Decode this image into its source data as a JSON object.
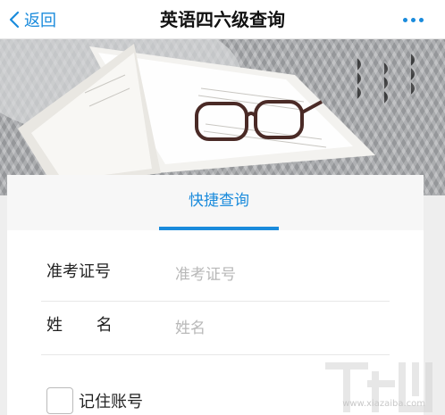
{
  "nav": {
    "back_label": "返回",
    "title": "英语四六级查询"
  },
  "tabs": [
    {
      "label": "快捷查询",
      "active": true
    }
  ],
  "form": {
    "ticket_label": "准考证号",
    "ticket_placeholder": "准考证号",
    "name_label": "姓 名",
    "name_placeholder": "姓名",
    "remember_label": "记住账号",
    "remember_checked": false
  },
  "watermark": {
    "text": "www.xiazaiba.com"
  },
  "colors": {
    "accent": "#1a8bdc",
    "background": "#eeeeee",
    "card": "#ffffff",
    "label": "#222222",
    "placeholder": "#b8b8b8"
  },
  "icons": {
    "back": "chevron-left-icon",
    "more": "more-dots-icon",
    "checkbox": "checkbox-icon"
  }
}
